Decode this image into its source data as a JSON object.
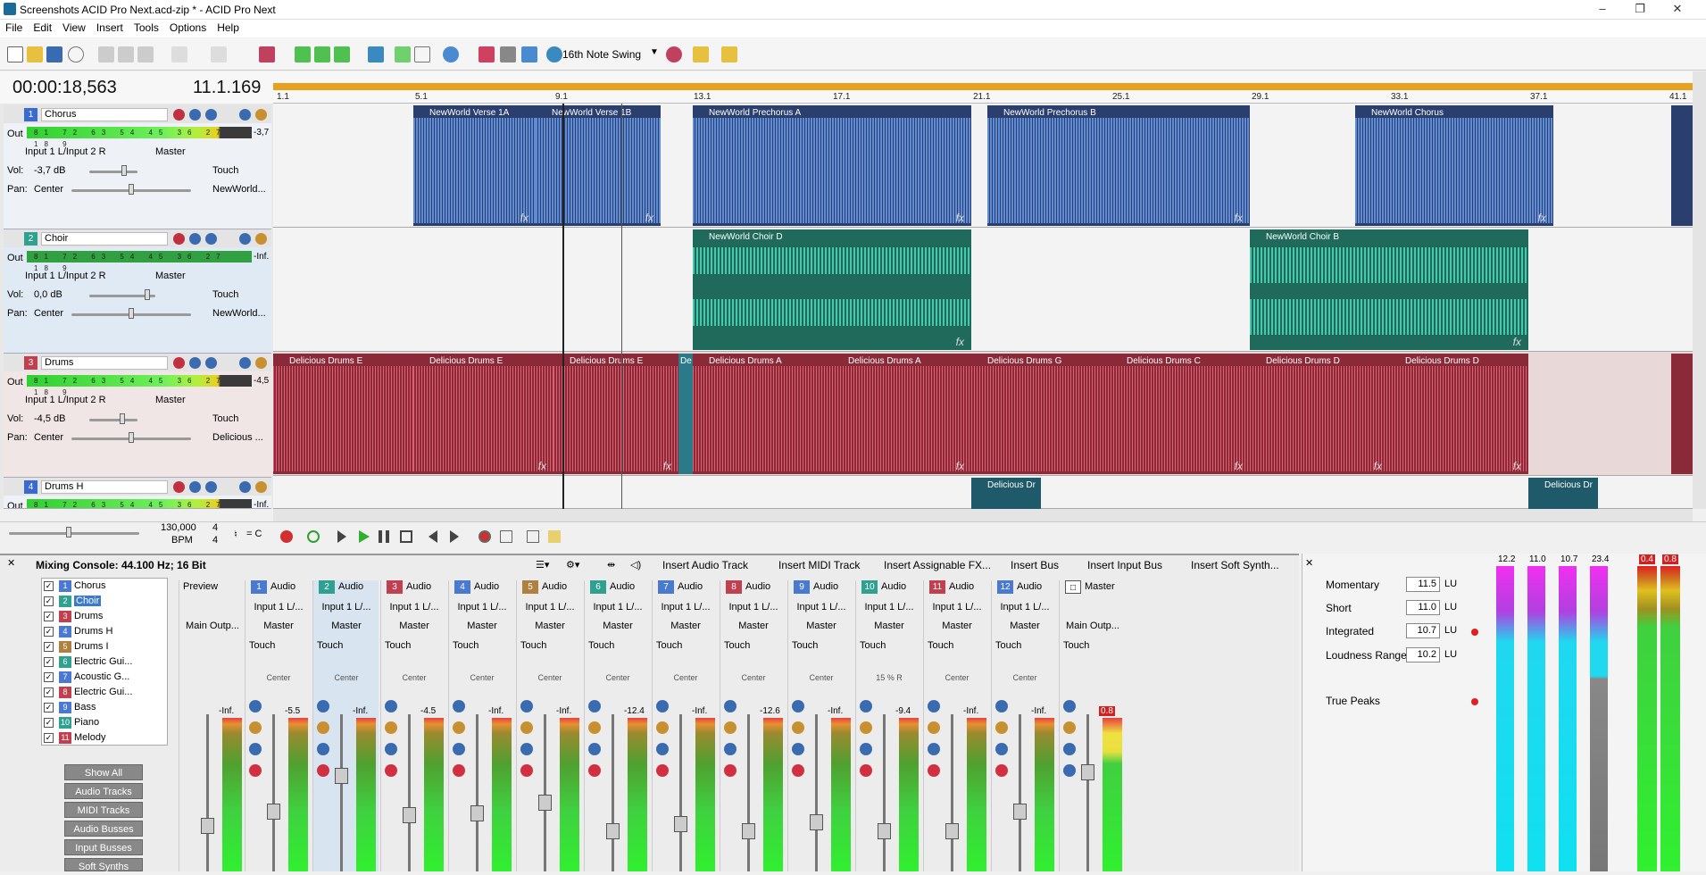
{
  "window": {
    "title": "Screenshots ACID Pro Next.acd-zip * - ACID Pro Next",
    "minimize": "–",
    "maximize": "❐",
    "close": "✕"
  },
  "menu": [
    "File",
    "Edit",
    "View",
    "Insert",
    "Tools",
    "Options",
    "Help"
  ],
  "toolbar": {
    "swing": "16th Note Swing"
  },
  "time": {
    "timecode": "00:00:18,563",
    "beat": "11.1.169"
  },
  "ruler": [
    "1.1",
    "5.1",
    "9.1",
    "13.1",
    "17.1",
    "21.1",
    "25.1",
    "29.1",
    "33.1",
    "37.1",
    "41.1"
  ],
  "tracks": [
    {
      "num": "1",
      "name": "Chorus",
      "out": "Out",
      "meter": "-3,7",
      "input": "Input 1 L/Input 2 R",
      "master": "Master",
      "vol_lbl": "Vol:",
      "vol": "-3,7 dB",
      "touch": "Touch",
      "pan_lbl": "Pan:",
      "pan": "Center",
      "clipref": "NewWorld..."
    },
    {
      "num": "2",
      "name": "Choir",
      "out": "Out",
      "meter": "-Inf.",
      "input": "Input 1 L/Input 2 R",
      "master": "Master",
      "vol_lbl": "Vol:",
      "vol": "0,0 dB",
      "touch": "Touch",
      "pan_lbl": "Pan:",
      "pan": "Center",
      "clipref": "NewWorld..."
    },
    {
      "num": "3",
      "name": "Drums",
      "out": "Out",
      "meter": "-4,5",
      "input": "Input 1 L/Input 2 R",
      "master": "Master",
      "vol_lbl": "Vol:",
      "vol": "-4,5 dB",
      "touch": "Touch",
      "pan_lbl": "Pan:",
      "pan": "Center",
      "clipref": "Delicious ..."
    },
    {
      "num": "4",
      "name": "Drums H",
      "out": "Out",
      "meter": "-Inf."
    }
  ],
  "meter_ticks": "81 72 63 54 45 36 27 18 9",
  "clips": {
    "chorus": [
      "NewWorld Verse 1A",
      "NewWorld Verse 1B",
      "NewWorld Prechorus A",
      "NewWorld Prechorus B",
      "NewWorld Chorus"
    ],
    "choir": [
      "NewWorld Choir D",
      "NewWorld Choir B"
    ],
    "drums": [
      "Delicious Drums E",
      "Delicious Drums E",
      "Delicious Drums E",
      "De",
      "Delicious Drums A",
      "Delicious Drums A",
      "Delicious Drums G",
      "Delicious Drums C",
      "Delicious Drums D",
      "Delicious Drums D"
    ],
    "drumsh": [
      "Delicious Dr",
      "Delicious Dr"
    ],
    "fx": "fx"
  },
  "transport": {
    "bpm": "130,000",
    "bpm_lbl": "BPM",
    "sig_top": "4",
    "sig_bot": "4",
    "key": "= C"
  },
  "mixer": {
    "title": "Mixing Console: 44.100 Hz; 16 Bit",
    "buttons": [
      "Insert Audio Track",
      "Insert MIDI Track",
      "Insert Assignable FX...",
      "Insert Bus",
      "Insert Input Bus",
      "Insert Soft Synth..."
    ],
    "list": [
      {
        "n": "1",
        "name": "Chorus",
        "c": "#4a7ad0"
      },
      {
        "n": "2",
        "name": "Choir",
        "c": "#30a090"
      },
      {
        "n": "3",
        "name": "Drums",
        "c": "#c04050"
      },
      {
        "n": "4",
        "name": "Drums H",
        "c": "#4a7ad0"
      },
      {
        "n": "5",
        "name": "Drums I",
        "c": "#b08040"
      },
      {
        "n": "6",
        "name": "Electric Gui...",
        "c": "#30a090"
      },
      {
        "n": "7",
        "name": "Acoustic G...",
        "c": "#4a7ad0"
      },
      {
        "n": "8",
        "name": "Electric Gui...",
        "c": "#c04050"
      },
      {
        "n": "9",
        "name": "Bass",
        "c": "#4a7ad0"
      },
      {
        "n": "10",
        "name": "Piano",
        "c": "#30a090"
      },
      {
        "n": "11",
        "name": "Melody",
        "c": "#c04050"
      }
    ],
    "filters": [
      "Show All",
      "Audio Tracks",
      "MIDI Tracks",
      "Audio Busses",
      "Input Busses",
      "Soft Synths"
    ],
    "preview": {
      "label": "Preview",
      "out": "Main Outp...",
      "val": "-Inf."
    },
    "strips": [
      {
        "n": "1",
        "type": "Audio",
        "in": "Input 1 L/...",
        "out": "Master",
        "touch": "Touch",
        "pan": "Center",
        "val": "-5.5",
        "c": "#4a7ad0"
      },
      {
        "n": "2",
        "type": "Audio",
        "in": "Input 1 L/...",
        "out": "Master",
        "touch": "Touch",
        "pan": "Center",
        "val": "-Inf.",
        "c": "#30a090"
      },
      {
        "n": "3",
        "type": "Audio",
        "in": "Input 1 L/...",
        "out": "Master",
        "touch": "Touch",
        "pan": "Center",
        "val": "-4.5",
        "c": "#c04050"
      },
      {
        "n": "4",
        "type": "Audio",
        "in": "Input 1 L/...",
        "out": "Master",
        "touch": "Touch",
        "pan": "Center",
        "val": "-Inf.",
        "c": "#4a7ad0"
      },
      {
        "n": "5",
        "type": "Audio",
        "in": "Input 1 L/...",
        "out": "Master",
        "touch": "Touch",
        "pan": "Center",
        "val": "-Inf.",
        "c": "#b08040"
      },
      {
        "n": "6",
        "type": "Audio",
        "in": "Input 1 L/...",
        "out": "Master",
        "touch": "Touch",
        "pan": "Center",
        "val": "-12.4",
        "c": "#30a090"
      },
      {
        "n": "7",
        "type": "Audio",
        "in": "Input 1 L/...",
        "out": "Master",
        "touch": "Touch",
        "pan": "Center",
        "val": "-Inf.",
        "c": "#4a7ad0"
      },
      {
        "n": "8",
        "type": "Audio",
        "in": "Input 1 L/...",
        "out": "Master",
        "touch": "Touch",
        "pan": "Center",
        "val": "-12.6",
        "c": "#c04050"
      },
      {
        "n": "9",
        "type": "Audio",
        "in": "Input 1 L/...",
        "out": "Master",
        "touch": "Touch",
        "pan": "Center",
        "val": "-Inf.",
        "c": "#4a7ad0"
      },
      {
        "n": "10",
        "type": "Audio",
        "in": "Input 1 L/...",
        "out": "Master",
        "touch": "Touch",
        "pan": "15 % R",
        "val": "-9.4",
        "c": "#30a090"
      },
      {
        "n": "11",
        "type": "Audio",
        "in": "Input 1 L/...",
        "out": "Master",
        "touch": "Touch",
        "pan": "Center",
        "val": "-Inf.",
        "c": "#c04050"
      },
      {
        "n": "12",
        "type": "Audio",
        "in": "Input 1 L/...",
        "out": "Master",
        "touch": "Touch",
        "pan": "Center",
        "val": "-Inf.",
        "c": "#4a7ad0"
      }
    ],
    "master": {
      "label": "Master",
      "out": "Main Outp...",
      "touch": "Touch",
      "val": "0.8"
    }
  },
  "loudness": {
    "momentary_lbl": "Momentary",
    "momentary": "11.5",
    "short_lbl": "Short",
    "short": "11.0",
    "integrated_lbl": "Integrated",
    "integrated": "10.7",
    "range_lbl": "Loudness Range",
    "range": "10.2",
    "unit": "LU",
    "truepeaks_lbl": "True Peaks",
    "meter_tops": [
      "12.2",
      "11.0",
      "10.7",
      "23.4"
    ],
    "peak_tops": [
      "0.4",
      "0.8"
    ]
  }
}
